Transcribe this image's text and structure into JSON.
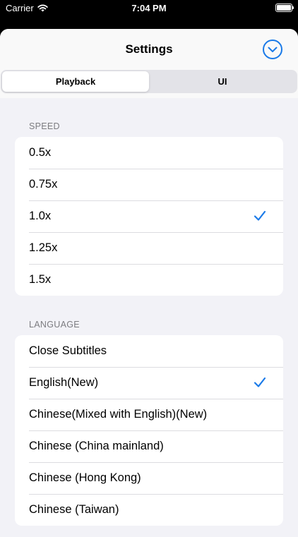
{
  "status_bar": {
    "carrier": "Carrier",
    "time": "7:04 PM"
  },
  "nav": {
    "title": "Settings",
    "dismiss_icon": "chevron-down-circle-icon"
  },
  "segments": [
    {
      "label": "Playback",
      "selected": true
    },
    {
      "label": "UI",
      "selected": false
    }
  ],
  "speed": {
    "header": "SPEED",
    "options": [
      {
        "label": "0.5x",
        "selected": false
      },
      {
        "label": "0.75x",
        "selected": false
      },
      {
        "label": "1.0x",
        "selected": true
      },
      {
        "label": "1.25x",
        "selected": false
      },
      {
        "label": "1.5x",
        "selected": false
      }
    ]
  },
  "language": {
    "header": "LANGUAGE",
    "options": [
      {
        "label": "Close Subtitles",
        "selected": false
      },
      {
        "label": "English(New)",
        "selected": true
      },
      {
        "label": "Chinese(Mixed with English)(New)",
        "selected": false
      },
      {
        "label": "Chinese (China mainland)",
        "selected": false
      },
      {
        "label": "Chinese (Hong Kong)",
        "selected": false
      },
      {
        "label": "Chinese (Taiwan)",
        "selected": false
      }
    ]
  },
  "colors": {
    "accent": "#1a7ae8",
    "background": "#f2f2f7"
  }
}
